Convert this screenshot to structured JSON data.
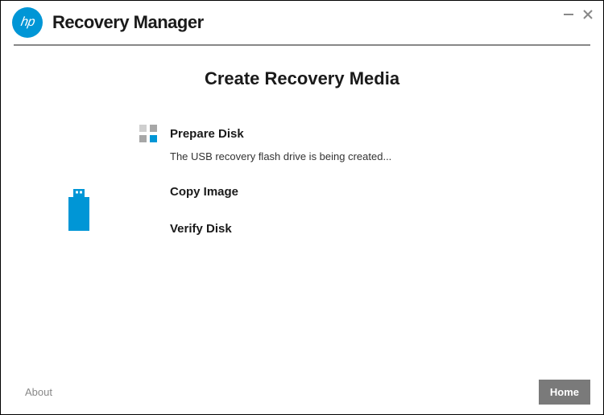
{
  "app": {
    "logo_text": "hp",
    "title": "Recovery Manager"
  },
  "page": {
    "heading": "Create Recovery Media"
  },
  "steps": {
    "prepare": {
      "label": "Prepare Disk",
      "status": "The USB recovery flash drive is being created..."
    },
    "copy": {
      "label": "Copy Image"
    },
    "verify": {
      "label": "Verify Disk"
    }
  },
  "footer": {
    "about": "About",
    "home": "Home"
  }
}
